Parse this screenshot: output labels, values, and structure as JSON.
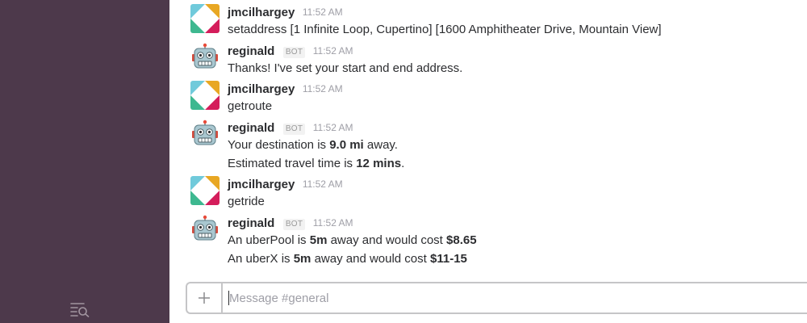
{
  "channel": {
    "name": "#general"
  },
  "composer": {
    "placeholder": "Message #general",
    "plus_icon": "plus-icon"
  },
  "sidebar": {
    "search_icon": "search-list-icon"
  },
  "messages": [
    {
      "author": "jmcilhargey",
      "time": "11:52 AM",
      "avatar": "slack-logo-avatar",
      "lines": [
        "setaddress [1 Infinite Loop, Cupertino] [1600 Amphitheater Drive, Mountain View]"
      ]
    },
    {
      "author": "reginald",
      "bot_tag": "BOT",
      "time": "11:52 AM",
      "avatar": "robot-avatar",
      "lines": [
        "Thanks! I've set your start and end address."
      ]
    },
    {
      "author": "jmcilhargey",
      "time": "11:52 AM",
      "avatar": "slack-logo-avatar",
      "lines": [
        "getroute"
      ]
    },
    {
      "author": "reginald",
      "bot_tag": "BOT",
      "time": "11:52 AM",
      "avatar": "robot-avatar",
      "lines": [
        {
          "prefix": "Your destination is ",
          "bold": "9.0 mi",
          "suffix": " away."
        },
        {
          "prefix": "Estimated travel time is ",
          "bold": "12 mins",
          "suffix": "."
        }
      ]
    },
    {
      "author": "jmcilhargey",
      "time": "11:52 AM",
      "avatar": "slack-logo-avatar",
      "lines": [
        "getride"
      ]
    },
    {
      "author": "reginald",
      "bot_tag": "BOT",
      "time": "11:52 AM",
      "avatar": "robot-avatar",
      "lines": [
        {
          "prefix": "An uberPool is ",
          "bold": "5m",
          "mid": " away and would cost ",
          "bold2": "$8.65"
        },
        {
          "prefix": "An uberX is ",
          "bold": "5m",
          "mid": " away and would cost ",
          "bold2": "$11-15"
        }
      ]
    }
  ]
}
